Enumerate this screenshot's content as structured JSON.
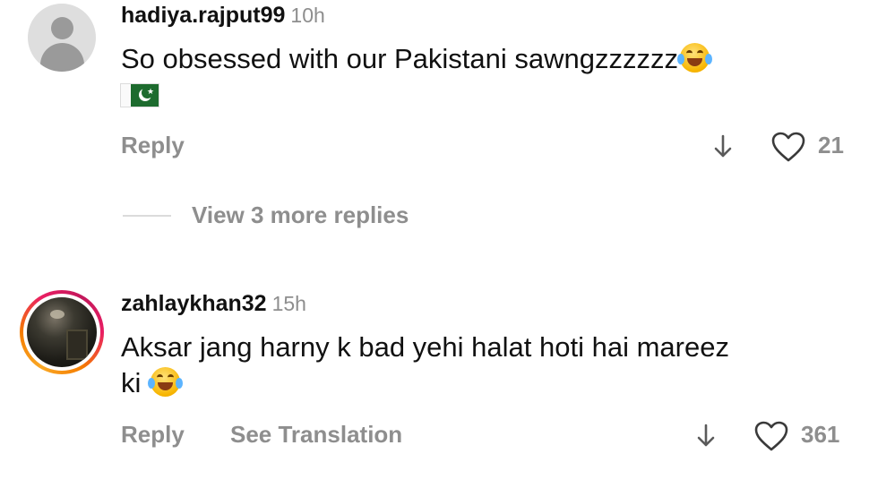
{
  "comments": [
    {
      "username": "hadiya.rajput99",
      "time": "10h",
      "text": "So obsessed with our Pakistani sawngzzzzzz",
      "emoji": "face-with-tears-of-joy-icon",
      "flag": "pakistan-flag-icon",
      "reply_label": "Reply",
      "likes": "21",
      "view_replies": "View 3 more replies"
    },
    {
      "username": "zahlaykhan32",
      "time": "15h",
      "text_line1": "Aksar jang harny k bad yehi halat hoti hai mareez",
      "text_line2": "ki",
      "emoji": "face-with-tears-of-joy-icon",
      "reply_label": "Reply",
      "translate_label": "See Translation",
      "likes": "361"
    }
  ],
  "icons": {
    "avatar_placeholder": "default-avatar-icon",
    "story_ring_colors": [
      "#f9a825",
      "#e91e63"
    ],
    "downvote": "arrow-down-icon",
    "like": "heart-outline-icon"
  }
}
